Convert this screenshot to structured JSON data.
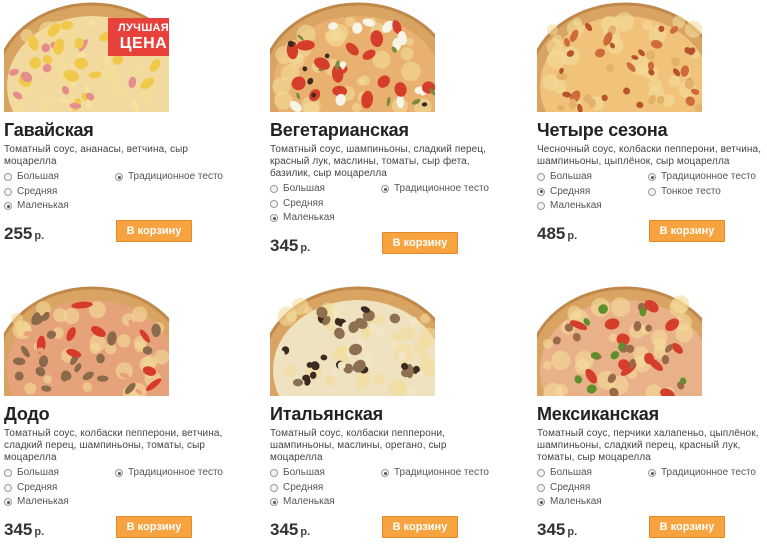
{
  "radio_labels": {
    "large": "Большая",
    "medium": "Средняя",
    "small": "Маленькая",
    "traditional": "Традиционное тесто",
    "thin": "Тонкое тесто"
  },
  "currency": "р.",
  "cart_button": "В корзину",
  "badge": {
    "line1": "ЛУЧШАЯ",
    "line2": "ЦЕНА"
  },
  "products": [
    {
      "name": "Гавайская",
      "description": "Томатный соус, ананасы, ветчина, сыр моцарелла",
      "price": "255",
      "size_selected": "small",
      "dough": [
        "traditional"
      ],
      "dough_selected": "traditional",
      "best_price": true
    },
    {
      "name": "Вегетарианская",
      "description": "Томатный соус, шампиньоны, сладкий перец, красный лук, маслины, томаты, сыр фета, базилик, сыр моцарелла",
      "price": "345",
      "size_selected": "small",
      "dough": [
        "traditional"
      ],
      "dough_selected": "traditional",
      "best_price": false
    },
    {
      "name": "Четыре сезона",
      "description": "Чесночный соус, колбаски пепперони, ветчина, шампиньоны, цыплёнок, сыр моцарелла",
      "price": "485",
      "size_selected": "medium",
      "dough": [
        "traditional",
        "thin"
      ],
      "dough_selected": "traditional",
      "best_price": false
    },
    {
      "name": "Додо",
      "description": "Томатный соус, колбаски пепперони, ветчина, сладкий перец, шампиньоны, томаты, сыр моцарелла",
      "price": "345",
      "size_selected": "small",
      "dough": [
        "traditional"
      ],
      "dough_selected": "traditional",
      "best_price": false
    },
    {
      "name": "Итальянская",
      "description": "Томатный соус, колбаски пепперони, шампиньоны, маслины, орегано, сыр моцарелла",
      "price": "345",
      "size_selected": "small",
      "dough": [
        "traditional"
      ],
      "dough_selected": "traditional",
      "best_price": false
    },
    {
      "name": "Мексиканская",
      "description": "Томатный соус, перчики халапеньо, цыплёнок, шампиньоны, сладкий перец, красный лук, томаты, сыр моцарелла",
      "price": "345",
      "size_selected": "small",
      "dough": [
        "traditional"
      ],
      "dough_selected": "traditional",
      "best_price": false
    }
  ],
  "colors": {
    "button_bg": "#f6a340",
    "badge_bg": "#e8403a",
    "crust": "#d9a462",
    "cheese": "#f3dc9a",
    "sauce": "#d8542d"
  }
}
